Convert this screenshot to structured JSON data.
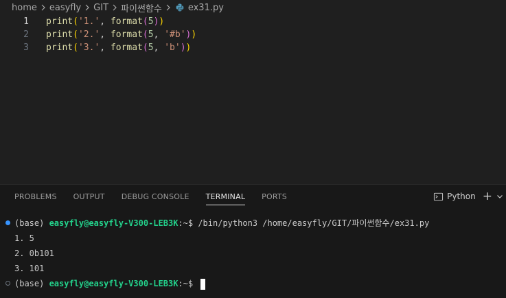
{
  "breadcrumb": {
    "items": [
      "home",
      "easyfly",
      "GIT",
      "파이썬함수"
    ],
    "file": "ex31.py"
  },
  "editor": {
    "lines": [
      {
        "num": "1",
        "tokens": [
          [
            "fn",
            "print"
          ],
          [
            "p1",
            "("
          ],
          [
            "str",
            "'1.'"
          ],
          [
            "plain",
            ", "
          ],
          [
            "fn",
            "format"
          ],
          [
            "p2",
            "("
          ],
          [
            "num",
            "5"
          ],
          [
            "p2",
            ")"
          ],
          [
            "p1",
            ")"
          ]
        ]
      },
      {
        "num": "2",
        "tokens": [
          [
            "fn",
            "print"
          ],
          [
            "p1",
            "("
          ],
          [
            "str",
            "'2.'"
          ],
          [
            "plain",
            ", "
          ],
          [
            "fn",
            "format"
          ],
          [
            "p2",
            "("
          ],
          [
            "num",
            "5"
          ],
          [
            "plain",
            ", "
          ],
          [
            "str",
            "'#b'"
          ],
          [
            "p2",
            ")"
          ],
          [
            "p1",
            ")"
          ]
        ]
      },
      {
        "num": "3",
        "tokens": [
          [
            "fn",
            "print"
          ],
          [
            "p1",
            "("
          ],
          [
            "str",
            "'3.'"
          ],
          [
            "plain",
            ", "
          ],
          [
            "fn",
            "format"
          ],
          [
            "p2",
            "("
          ],
          [
            "num",
            "5"
          ],
          [
            "plain",
            ", "
          ],
          [
            "str",
            "'b'"
          ],
          [
            "p2",
            ")"
          ],
          [
            "p1",
            ")"
          ]
        ]
      }
    ]
  },
  "panel": {
    "tabs": [
      "PROBLEMS",
      "OUTPUT",
      "DEBUG CONSOLE",
      "TERMINAL",
      "PORTS"
    ],
    "active_tab": "TERMINAL",
    "terminal_profile": "Python",
    "plus_label": "+"
  },
  "terminal": {
    "prompt_env": "(base) ",
    "prompt_user": "easyfly@easyfly-V300-LEB3K",
    "prompt_tail": ":~$ ",
    "command": "/bin/python3 /home/easyfly/GIT/파이썬함수/ex31.py",
    "outputs": [
      "1. 5",
      "2. 0b101",
      "3. 101"
    ]
  },
  "colors": {
    "background": "#1f1f1f",
    "panel_background": "#181818",
    "prompt_user": "#23d18b",
    "success_dot": "#3794ff"
  }
}
